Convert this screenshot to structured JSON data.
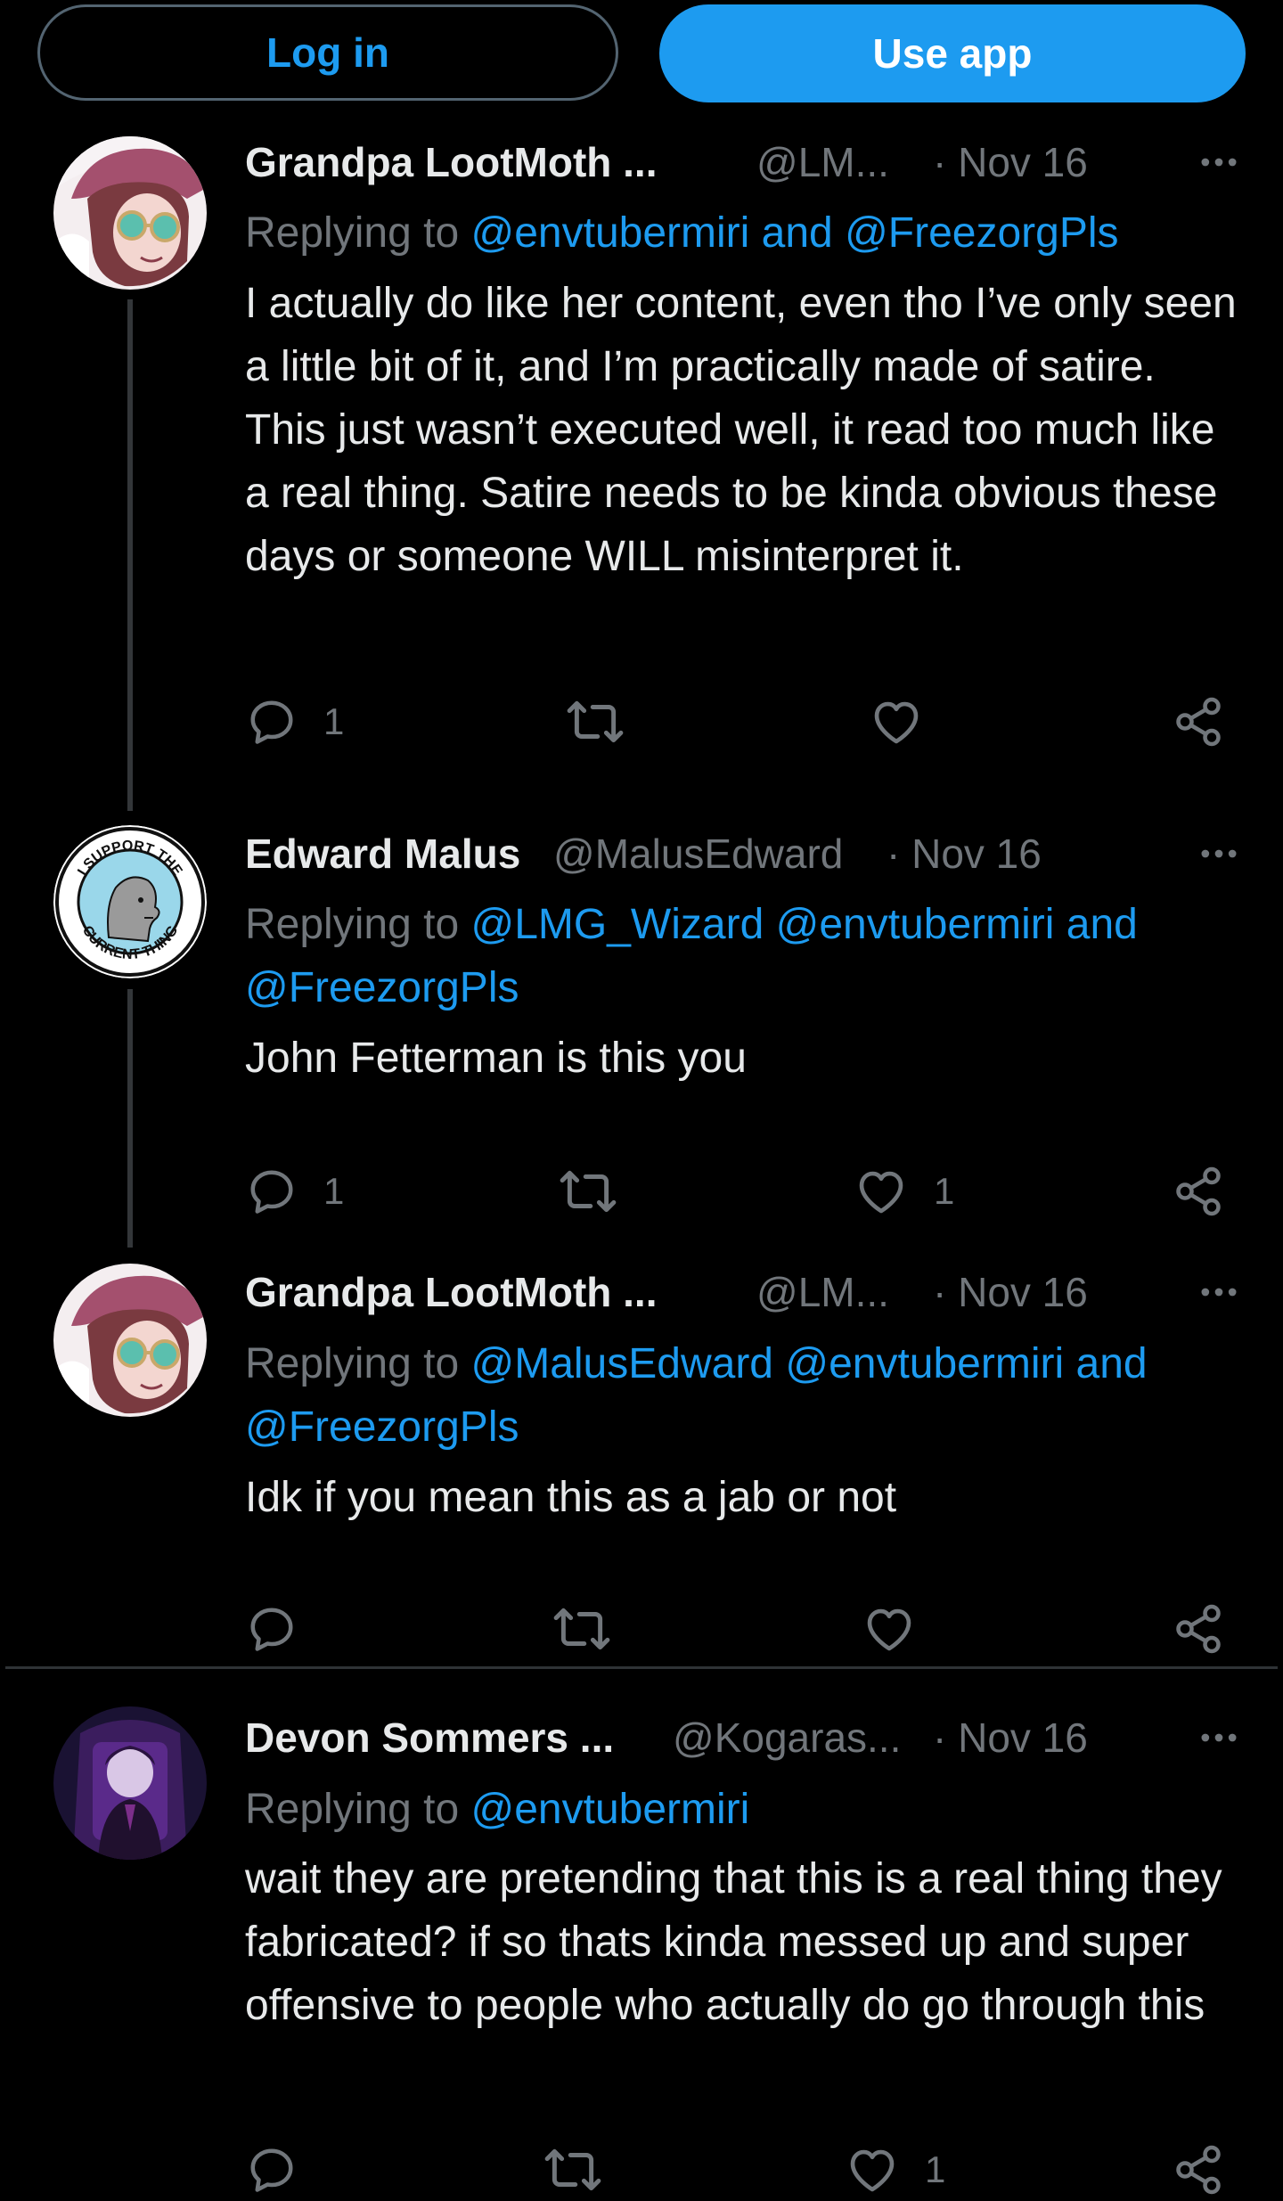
{
  "top_bar": {
    "login_label": "Log in",
    "use_app_label": "Use app"
  },
  "colors": {
    "background": "#000000",
    "accent": "#1d9bf0",
    "secondary_text": "#71767b",
    "primary_text": "#e7e9ea"
  },
  "tweets": [
    {
      "name": "Grandpa LootMoth ...",
      "handle": "@LM...",
      "date": "· Nov 16",
      "replying_prefix": "Replying to",
      "replying_mentions": "@envtubermiri and @FreezorgPls",
      "body": "I actually do like her content, even tho I’ve only seen a little bit of it, and I’m practically made of satire. This just wasn’t executed well, it read too much like a real thing. Satire needs to be kinda obvious these days or someone WILL misinterpret it.",
      "reply_count": "1",
      "retweet_count": "",
      "like_count": ""
    },
    {
      "name": "Edward Malus",
      "handle": "@MalusEdward",
      "date": "· Nov 16",
      "replying_prefix": "Replying to",
      "replying_mentions": "@LMG_Wizard @envtubermiri and @FreezorgPls",
      "body": "John Fetterman is this you",
      "reply_count": "1",
      "retweet_count": "",
      "like_count": "1",
      "avatar_text_top": "I SUPPORT THE",
      "avatar_text_bottom": "CURRENT THING"
    },
    {
      "name": "Grandpa LootMoth ...",
      "handle": "@LM...",
      "date": "· Nov 16",
      "replying_prefix": "Replying to",
      "replying_mentions": "@MalusEdward @envtubermiri and @FreezorgPls",
      "body": "Idk if you mean this as a jab or not",
      "reply_count": "",
      "retweet_count": "",
      "like_count": ""
    },
    {
      "name": "Devon Sommers ...",
      "handle": "@Kogaras...",
      "date": "· Nov 16",
      "replying_prefix": "Replying to",
      "replying_mentions": "@envtubermiri",
      "body": "wait they are pretending that this is a real thing they fabricated? if so thats kinda messed up and super offensive to people who actually do go through this",
      "reply_count": "",
      "retweet_count": "",
      "like_count": "1"
    }
  ],
  "icons": {
    "reply": "reply-icon",
    "retweet": "retweet-icon",
    "like": "heart-icon",
    "share": "share-icon",
    "more": "more-icon"
  }
}
